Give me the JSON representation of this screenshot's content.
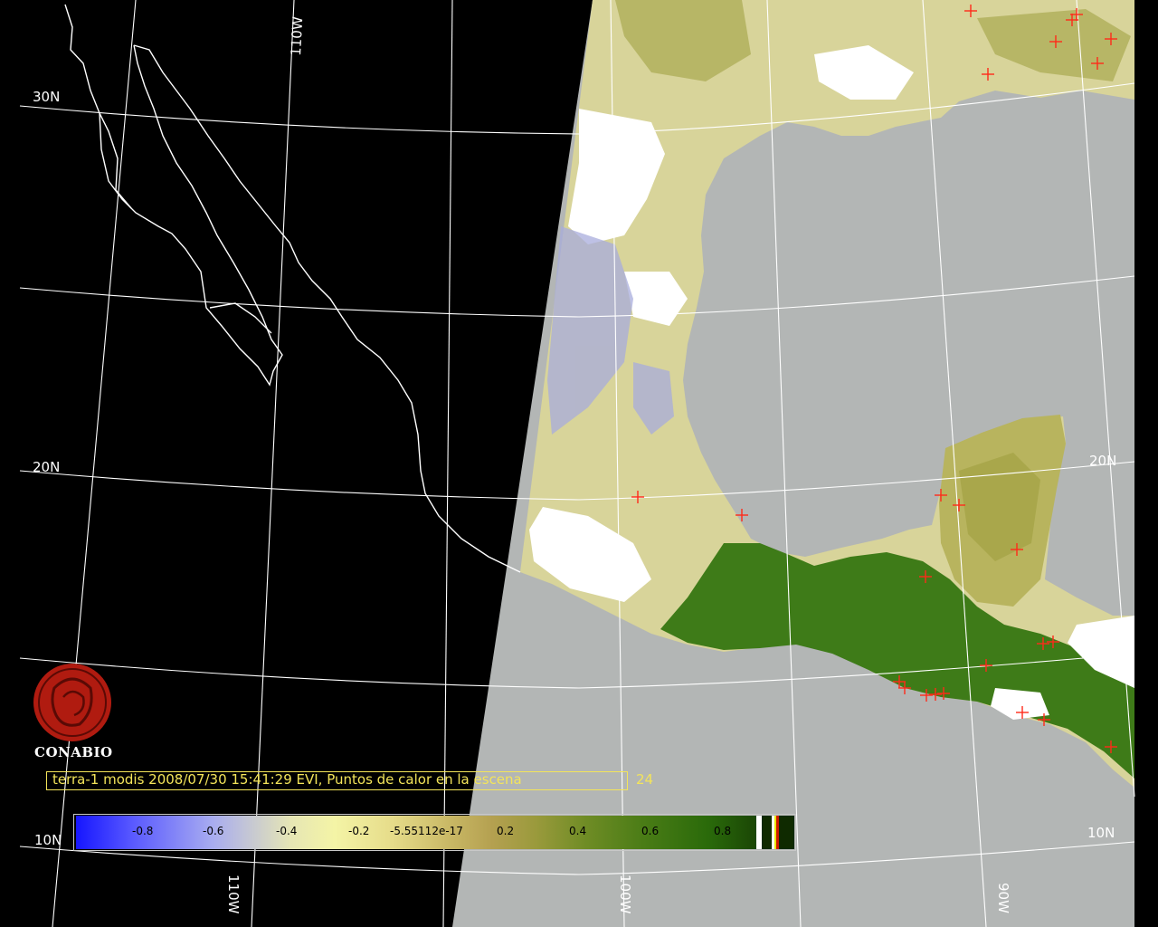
{
  "map": {
    "grid_labels": {
      "lat_30": "30N",
      "lat_20_left": "20N",
      "lat_20_right": "20N",
      "lat_10_left": "10N",
      "lat_10_right": "10N",
      "lon_110_top": "110W",
      "lon_110_bottom": "110W",
      "lon_100": "100W",
      "lon_90": "90W"
    },
    "colors": {
      "night_side": "#000000",
      "ocean": "#b3b6b5",
      "cloud": "#ffffff",
      "coastline": "#ffffff",
      "grid": "#ffffff",
      "hotspot": "#ff2a1a",
      "caption": "#f3e45a"
    },
    "hotspot_count": 24
  },
  "logo": {
    "name": "CONABIO",
    "icon": "conabio-logo-icon"
  },
  "caption": {
    "text": "terra-1 modis 2008/07/30 15:41:29 EVI, Puntos de calor en la escena",
    "count": "24"
  },
  "colorbar": {
    "ticks": [
      "-0.8",
      "-0.6",
      "-0.4",
      "-0.2",
      "-5.55112e-17",
      "0.2",
      "0.4",
      "0.6",
      "0.8"
    ],
    "end_swatches": [
      "#ffffff",
      "#0f2a00",
      "#ffffff",
      "#e8e800",
      "#cc1a00",
      "#0f2a00"
    ]
  }
}
